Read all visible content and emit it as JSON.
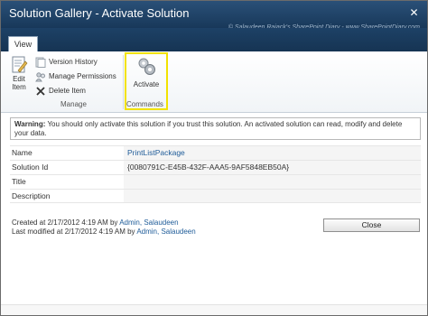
{
  "window": {
    "title": "Solution Gallery - Activate Solution",
    "watermark": "© Salaudeen Rajack's SharePoint Diary - www.SharePointDiary.com",
    "close_icon": "close-icon"
  },
  "ribbon": {
    "tab": "View",
    "manage": {
      "edit_label_1": "Edit",
      "edit_label_2": "Item",
      "version_history": "Version History",
      "manage_permissions": "Manage Permissions",
      "delete_item": "Delete Item",
      "group_label": "Manage"
    },
    "commands": {
      "activate": "Activate",
      "group_label": "Commands",
      "highlight_color": "#f2e200"
    }
  },
  "warning": {
    "prefix": "Warning:",
    "text": " You should only activate this solution if you trust this solution. An activated solution can read, modify and delete your data."
  },
  "properties": [
    {
      "name": "Name",
      "value": "PrintListPackage"
    },
    {
      "name": "Solution Id",
      "value": "{0080791C-E45B-432F-AAA5-9AF5848EB50A}"
    },
    {
      "name": "Title",
      "value": ""
    },
    {
      "name": "Description",
      "value": ""
    }
  ],
  "meta": {
    "created_prefix": "Created at 2/17/2012 4:19 AM by",
    "created_by": "Admin, Salaudeen",
    "modified_prefix": "Last modified at 2/17/2012 4:19 AM by",
    "modified_by": "Admin, Salaudeen"
  },
  "buttons": {
    "close": "Close"
  },
  "colors": {
    "titlebar": "#1e4670",
    "link": "#1f5c99",
    "highlight": "#f2e200"
  }
}
